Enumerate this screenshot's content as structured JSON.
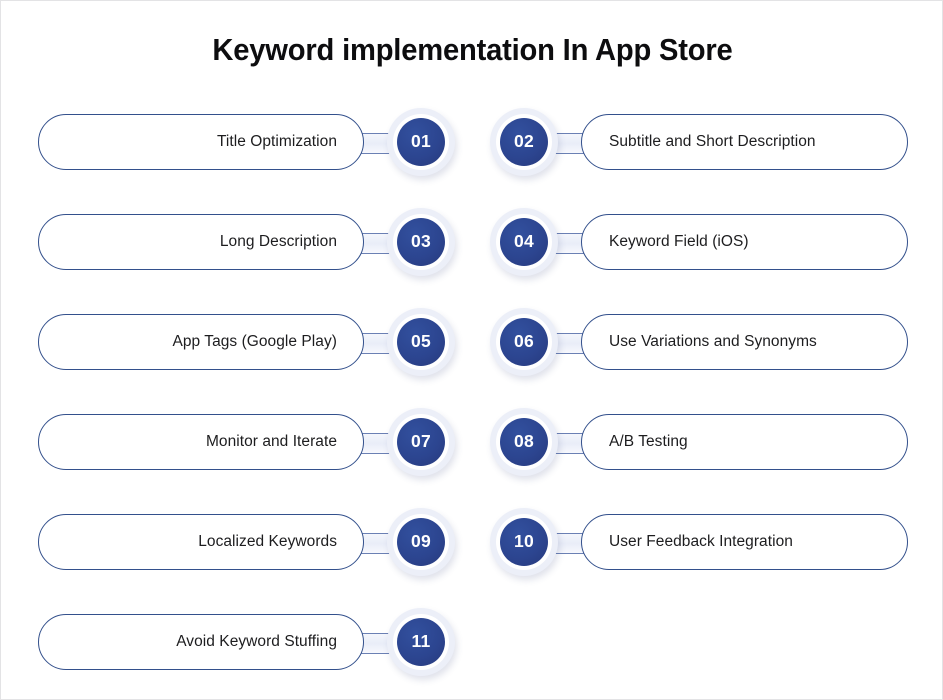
{
  "page": {
    "title": "Keyword implementation In App Store",
    "background_color": "#ffffff",
    "accent_color": "#2c4590",
    "pill_border_color": "#33508c",
    "badge_ring_color": "#eceff8",
    "label_text_color": "#1d1d1f"
  },
  "rows": [
    {
      "left": {
        "number": "01",
        "label": "Title Optimization"
      },
      "right": {
        "number": "02",
        "label": "Subtitle and Short Description"
      }
    },
    {
      "left": {
        "number": "03",
        "label": "Long Description"
      },
      "right": {
        "number": "04",
        "label": "Keyword Field (iOS)"
      }
    },
    {
      "left": {
        "number": "05",
        "label": "App Tags (Google Play)"
      },
      "right": {
        "number": "06",
        "label": "Use Variations and Synonyms"
      }
    },
    {
      "left": {
        "number": "07",
        "label": "Monitor and Iterate"
      },
      "right": {
        "number": "08",
        "label": "A/B Testing"
      }
    },
    {
      "left": {
        "number": "09",
        "label": "Localized Keywords"
      },
      "right": {
        "number": "10",
        "label": "User Feedback Integration"
      }
    },
    {
      "left": {
        "number": "11",
        "label": "Avoid Keyword Stuffing"
      },
      "right": null
    }
  ]
}
